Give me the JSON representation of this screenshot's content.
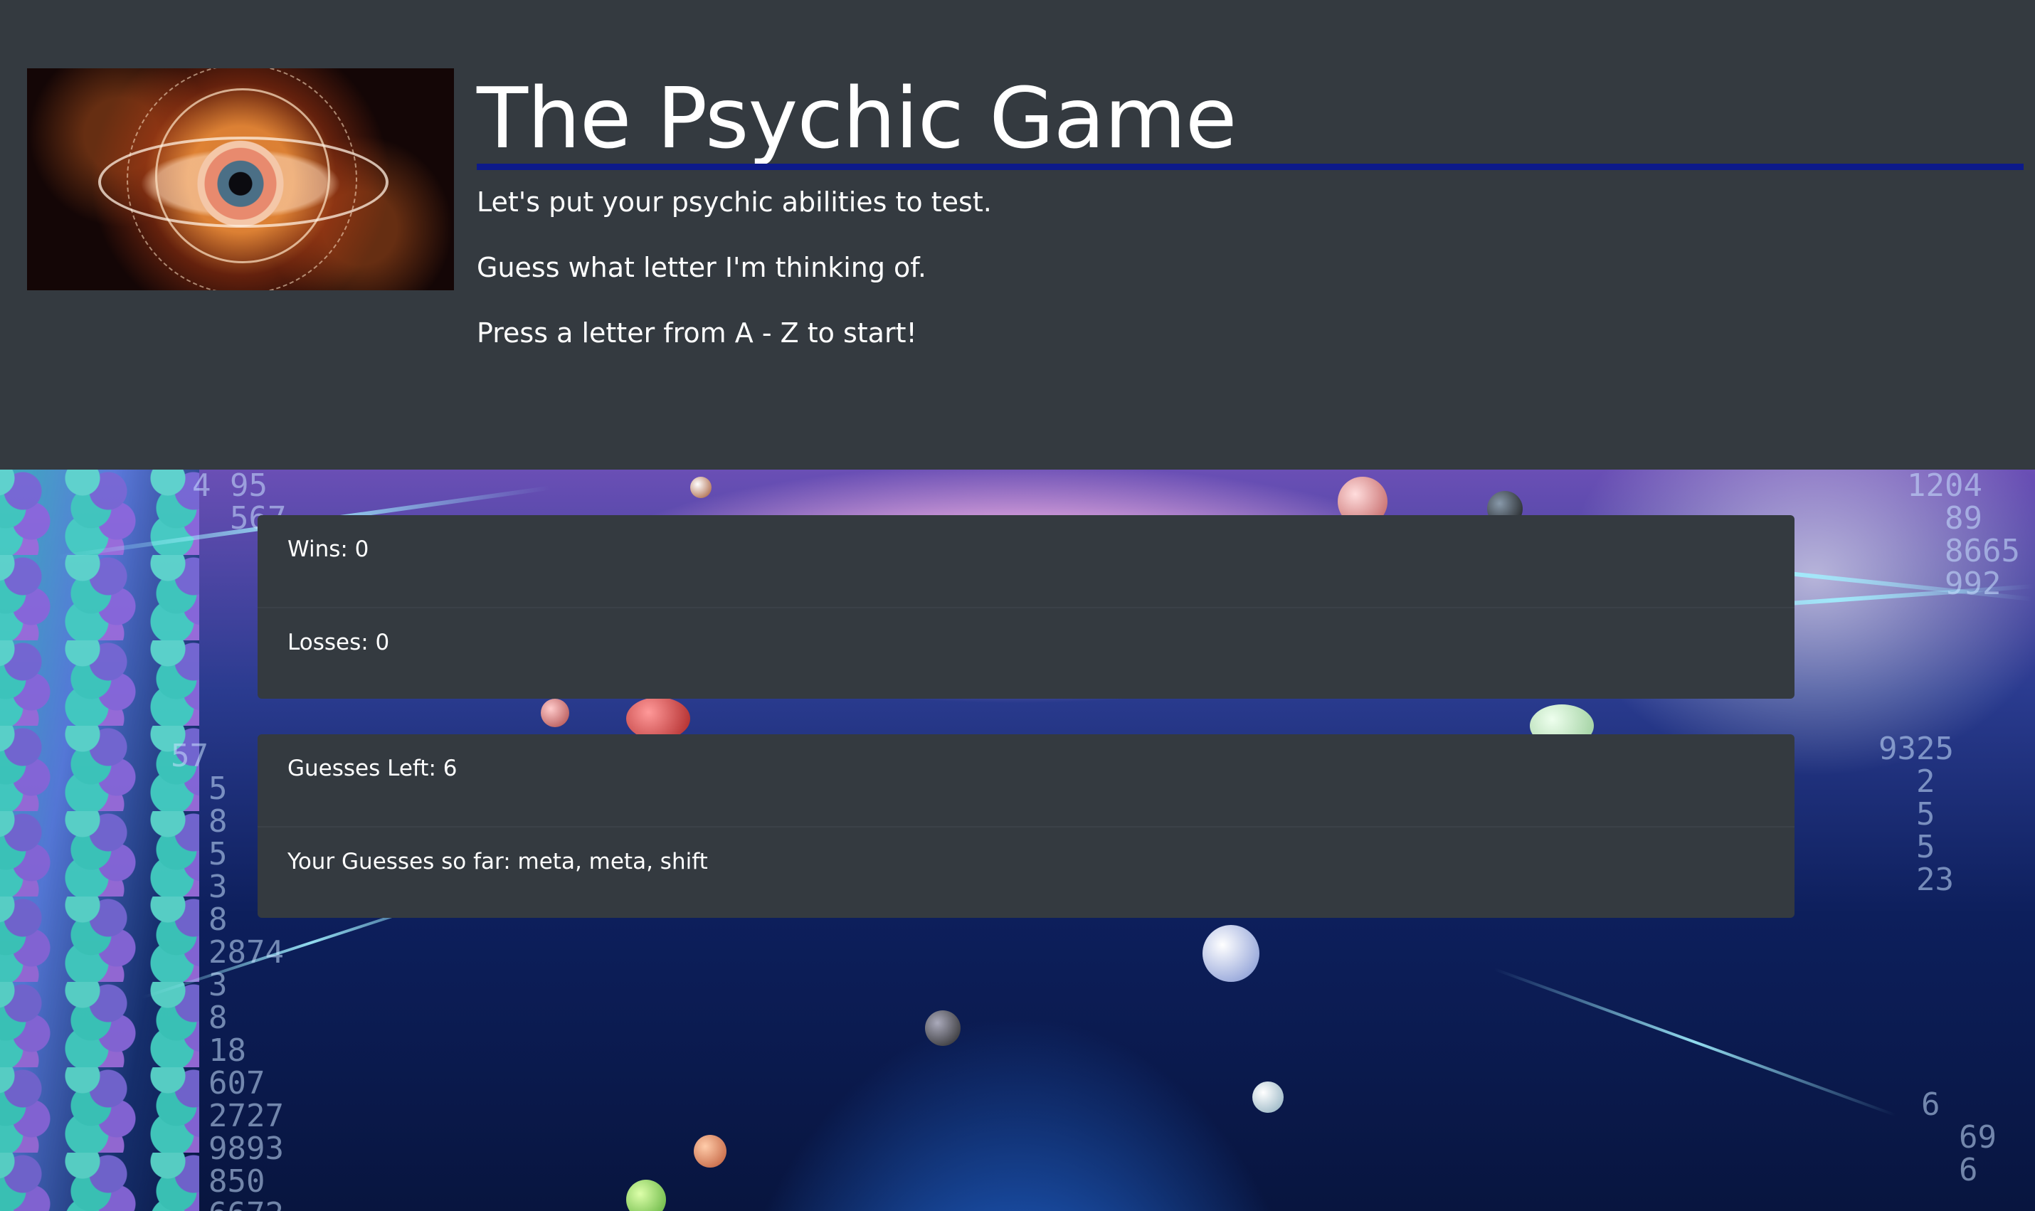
{
  "header": {
    "title": "The Psychic Game",
    "intro": [
      "Let's put your psychic abilities to test.",
      "Guess what letter I'm thinking of.",
      "Press a letter from A - Z to start!"
    ]
  },
  "scores": {
    "wins": "Wins: 0",
    "losses": "Losses: 0"
  },
  "status": {
    "guesses_left": "Guesses Left: 6",
    "guesses_so_far": "Your Guesses so far: meta, meta, shift"
  },
  "colors": {
    "page_bg": "#343a40",
    "card_bg": "#343a40",
    "rule": "#0d1a8a",
    "text": "#ffffff"
  }
}
